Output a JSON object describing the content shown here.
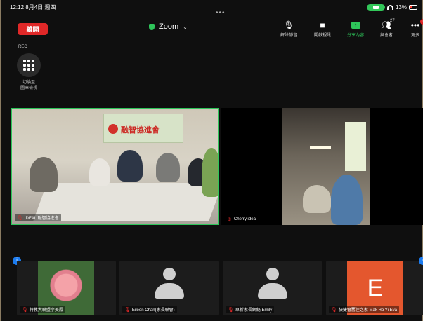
{
  "status": {
    "time_date": "12:12  8月4日 週四",
    "battery": "13%"
  },
  "toolbar": {
    "leave_label": "離開",
    "meeting_title": "Zoom",
    "unmute_label": "解除靜音",
    "video_label": "開啟視訊",
    "share_label": "分享內容",
    "participants_label": "與會者",
    "participants_count": "27",
    "more_label": "更多",
    "more_badge": "1"
  },
  "rec_label": "REC",
  "gallery_label": "切換至\n圖庫檢視",
  "tiles": {
    "main": {
      "name": "IDEAL 融智協進會"
    },
    "cherry": {
      "name": "Cherry ideal"
    },
    "small": [
      {
        "name": "特教大聯盟李美霞"
      },
      {
        "name": "Eileen Chan(家長聯會)"
      },
      {
        "name": "卓新家長網絡  Emily"
      },
      {
        "name": "快捷會舊住之家 Mak Ho Yi Eva",
        "initial": "E"
      }
    ]
  },
  "banner_text": "融智協進會",
  "colors": {
    "leave": "#e02828",
    "active_speaker": "#2ec55a",
    "share": "#2ec55a",
    "initial_bg": "#e4572e"
  }
}
